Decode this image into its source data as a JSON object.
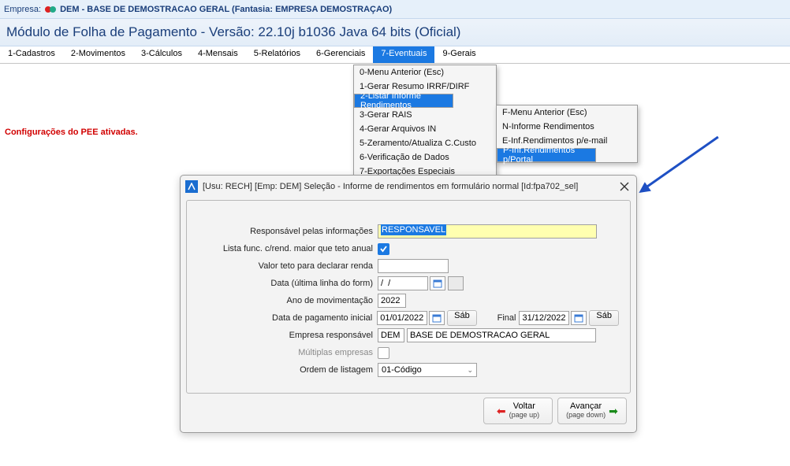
{
  "topbar": {
    "label": "Empresa:",
    "company": "DEM - BASE DE DEMOSTRACAO GERAL (Fantasia: EMPRESA DEMOSTRAÇAO)"
  },
  "module": "Módulo de Folha de Pagamento - Versão: 22.10j b1036 Java 64 bits (Oficial)",
  "menu": [
    "1-Cadastros",
    "2-Movimentos",
    "3-Cálculos",
    "4-Mensais",
    "5-Relatórios",
    "6-Gerenciais",
    "7-Eventuais",
    "9-Gerais"
  ],
  "menu_selected": 6,
  "dropdown1": {
    "items": [
      "0-Menu Anterior (Esc)",
      "1-Gerar Resumo IRRF/DIRF",
      "2-Listar Informe Rendimentos",
      "3-Gerar RAIS",
      "4-Gerar Arquivos IN",
      "5-Zeramento/Atualiza C.Custo",
      "6-Verificação de Dados",
      "7-Exportações Especiais"
    ],
    "selected": 2
  },
  "dropdown2": {
    "items": [
      "F-Menu Anterior (Esc)",
      "N-Informe Rendimentos",
      "E-Inf.Rendimentos p/e-mail",
      "P-Inf.Rendimentos p/Portal"
    ],
    "selected": 3
  },
  "status": "Configurações do PEE ativadas.",
  "dialog": {
    "title": "[Usu: RECH] [Emp: DEM] Seleção - Informe de rendimentos em formulário normal [Id:fpa702_sel]",
    "labels": {
      "responsavel": "Responsável pelas informações",
      "lista": "Lista func. c/rend. maior que teto anual",
      "valor_teto": "Valor teto para declarar renda",
      "data_ultima": "Data (última linha do form)",
      "ano": "Ano de movimentação",
      "data_pag_ini": "Data de pagamento inicial",
      "final": "Final",
      "empresa": "Empresa responsável",
      "multiplas": "Múltiplas empresas",
      "ordem": "Ordem de listagem"
    },
    "values": {
      "responsavel": "RESPONSAVEL",
      "valor_teto": "",
      "data_ultima": "/  /",
      "ano": "2022",
      "data_pag_ini": "01/01/2022",
      "data_pag_fim": "31/12/2022",
      "empresa_cod": "DEM",
      "empresa_nome": "BASE DE DEMOSTRACAO GERAL",
      "ordem": "01-Código",
      "day1": "Sáb",
      "day2": "Sáb"
    },
    "buttons": {
      "voltar": "Voltar",
      "voltar_sub": "(page up)",
      "avancar": "Avançar",
      "avancar_sub": "(page down)"
    }
  }
}
